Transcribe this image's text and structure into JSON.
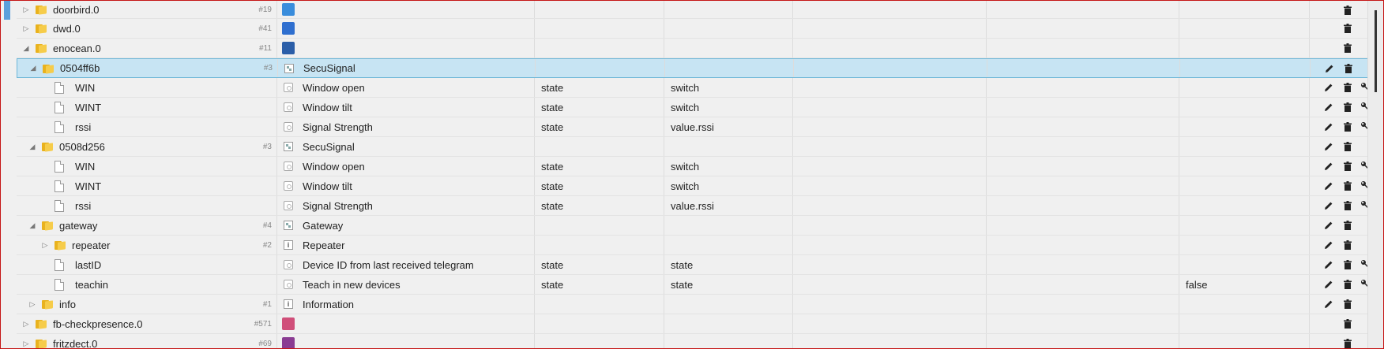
{
  "rows": [
    {
      "level": 1,
      "toggle": "▷",
      "kind": "folder",
      "id": "doorbird.0",
      "count": "#19",
      "icon": "doorbird-adapter-icon",
      "icon_color": "#3a8ddc",
      "name": "",
      "type": "",
      "role": "",
      "value": "",
      "actions": [
        "delete"
      ]
    },
    {
      "level": 1,
      "toggle": "▷",
      "kind": "folder",
      "id": "dwd.0",
      "count": "#41",
      "icon": "dwd-adapter-icon",
      "icon_color": "#2f6fcf",
      "name": "",
      "type": "",
      "role": "",
      "value": "",
      "actions": [
        "delete"
      ]
    },
    {
      "level": 1,
      "toggle": "◢",
      "kind": "folder",
      "id": "enocean.0",
      "count": "#11",
      "icon": "enocean-adapter-icon",
      "icon_color": "#2b5ea8",
      "name": "",
      "type": "",
      "role": "",
      "value": "",
      "actions": [
        "delete"
      ]
    },
    {
      "level": 2,
      "toggle": "◢",
      "kind": "folder",
      "id": "0504ff6b",
      "count": "#3",
      "icon": "device-icon",
      "name": "SecuSignal",
      "type": "",
      "role": "",
      "value": "",
      "actions": [
        "edit",
        "delete"
      ],
      "selected": true
    },
    {
      "level": 3,
      "toggle": "",
      "kind": "file",
      "id": "WIN",
      "count": "",
      "icon": "state-icon",
      "name": "Window open",
      "type": "state",
      "role": "switch",
      "value": "",
      "actions": [
        "edit",
        "delete",
        "settings"
      ]
    },
    {
      "level": 3,
      "toggle": "",
      "kind": "file",
      "id": "WINT",
      "count": "",
      "icon": "state-icon",
      "name": "Window tilt",
      "type": "state",
      "role": "switch",
      "value": "",
      "actions": [
        "edit",
        "delete",
        "settings"
      ]
    },
    {
      "level": 3,
      "toggle": "",
      "kind": "file",
      "id": "rssi",
      "count": "",
      "icon": "state-icon",
      "name": "Signal Strength",
      "type": "state",
      "role": "value.rssi",
      "value": "",
      "actions": [
        "edit",
        "delete",
        "settings"
      ]
    },
    {
      "level": 2,
      "toggle": "◢",
      "kind": "folder",
      "id": "0508d256",
      "count": "#3",
      "icon": "device-icon",
      "name": "SecuSignal",
      "type": "",
      "role": "",
      "value": "",
      "actions": [
        "edit",
        "delete"
      ]
    },
    {
      "level": 3,
      "toggle": "",
      "kind": "file",
      "id": "WIN",
      "count": "",
      "icon": "state-icon",
      "name": "Window open",
      "type": "state",
      "role": "switch",
      "value": "",
      "actions": [
        "edit",
        "delete",
        "settings"
      ]
    },
    {
      "level": 3,
      "toggle": "",
      "kind": "file",
      "id": "WINT",
      "count": "",
      "icon": "state-icon",
      "name": "Window tilt",
      "type": "state",
      "role": "switch",
      "value": "",
      "actions": [
        "edit",
        "delete",
        "settings"
      ]
    },
    {
      "level": 3,
      "toggle": "",
      "kind": "file",
      "id": "rssi",
      "count": "",
      "icon": "state-icon",
      "name": "Signal Strength",
      "type": "state",
      "role": "value.rssi",
      "value": "",
      "actions": [
        "edit",
        "delete",
        "settings"
      ]
    },
    {
      "level": 2,
      "toggle": "◢",
      "kind": "folder",
      "id": "gateway",
      "count": "#4",
      "icon": "device-icon",
      "name": "Gateway",
      "type": "",
      "role": "",
      "value": "",
      "actions": [
        "edit",
        "delete"
      ]
    },
    {
      "level": 3,
      "toggle": "▷",
      "kind": "folder",
      "id": "repeater",
      "count": "#2",
      "icon": "info-icon",
      "name": "Repeater",
      "type": "",
      "role": "",
      "value": "",
      "actions": [
        "edit",
        "delete"
      ]
    },
    {
      "level": 3,
      "toggle": "",
      "kind": "file",
      "id": "lastID",
      "count": "",
      "icon": "state-icon",
      "name": "Device ID from last received telegram",
      "type": "state",
      "role": "state",
      "value": "",
      "actions": [
        "edit",
        "delete",
        "settings"
      ]
    },
    {
      "level": 3,
      "toggle": "",
      "kind": "file",
      "id": "teachin",
      "count": "",
      "icon": "state-icon",
      "name": "Teach in new devices",
      "type": "state",
      "role": "state",
      "value": "false",
      "actions": [
        "edit",
        "delete",
        "settings"
      ]
    },
    {
      "level": 2,
      "toggle": "▷",
      "kind": "folder",
      "id": "info",
      "count": "#1",
      "icon": "info-icon",
      "name": "Information",
      "type": "",
      "role": "",
      "value": "",
      "actions": [
        "edit",
        "delete"
      ]
    },
    {
      "level": 1,
      "toggle": "▷",
      "kind": "folder",
      "id": "fb-checkpresence.0",
      "count": "#571",
      "icon": "fb-checkpresence-adapter-icon",
      "icon_color": "#d04f7a",
      "name": "",
      "type": "",
      "role": "",
      "value": "",
      "actions": [
        "delete"
      ]
    },
    {
      "level": 1,
      "toggle": "▷",
      "kind": "folder",
      "id": "fritzdect.0",
      "count": "#69",
      "icon": "fritzdect-adapter-icon",
      "icon_color": "#8a3c92",
      "name": "",
      "type": "",
      "role": "",
      "value": "",
      "actions": [
        "delete"
      ]
    }
  ]
}
